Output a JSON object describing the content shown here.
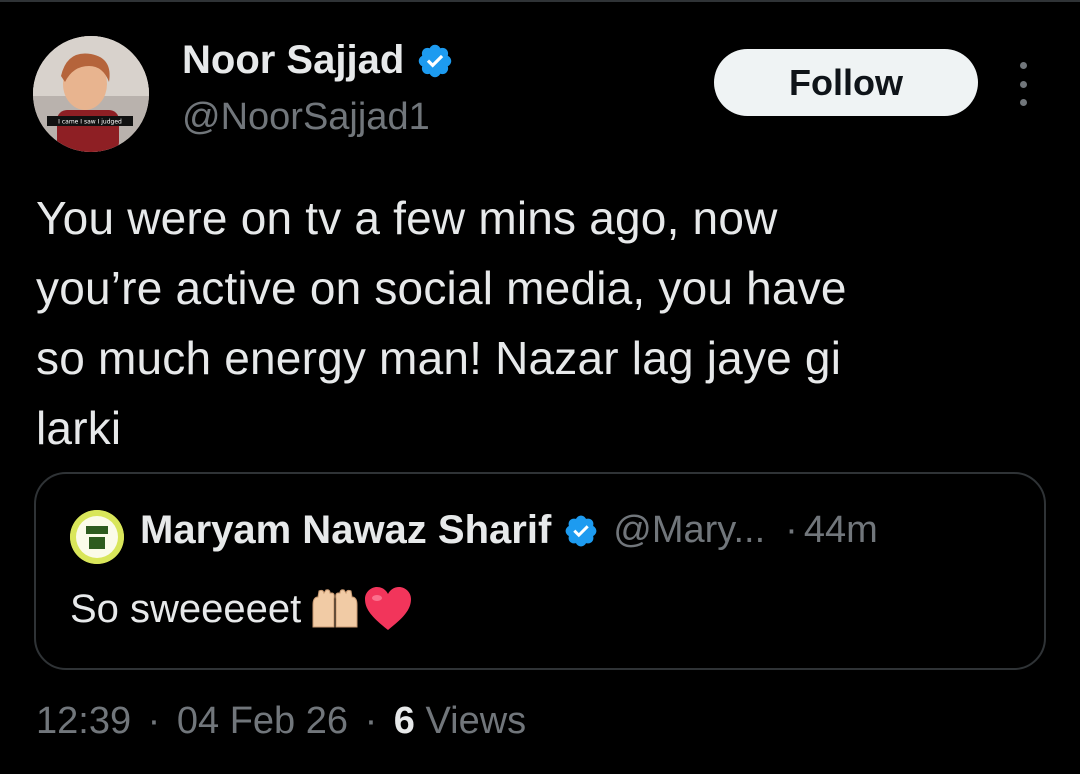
{
  "author": {
    "name": "Noor Sajjad",
    "handle": "@NoorSajjad1",
    "verified": true,
    "avatar_caption": "I came I saw I judged"
  },
  "follow_label": "Follow",
  "tweet_lines": [
    "You were on tv a few mins ago, now",
    "you’re active on social media, you have",
    "so much energy man! Nazar lag jaye gi",
    "larki"
  ],
  "quoted": {
    "name": "Maryam Nawaz Sharif",
    "handle": "@Mary...",
    "dot": "·",
    "time": "44m",
    "text": "So sweeeeet",
    "emojis": [
      "raising-hands",
      "red-heart"
    ]
  },
  "meta": {
    "time": "12:39",
    "sep": "·",
    "date": "04 Feb 26",
    "views_count": "6",
    "views_label": "Views"
  },
  "colors": {
    "background": "#000000",
    "text_primary": "#e7e9ea",
    "text_secondary": "#71767b",
    "verified_blue": "#1d9bf0",
    "border": "#2f3336",
    "follow_bg": "#eff3f4"
  }
}
